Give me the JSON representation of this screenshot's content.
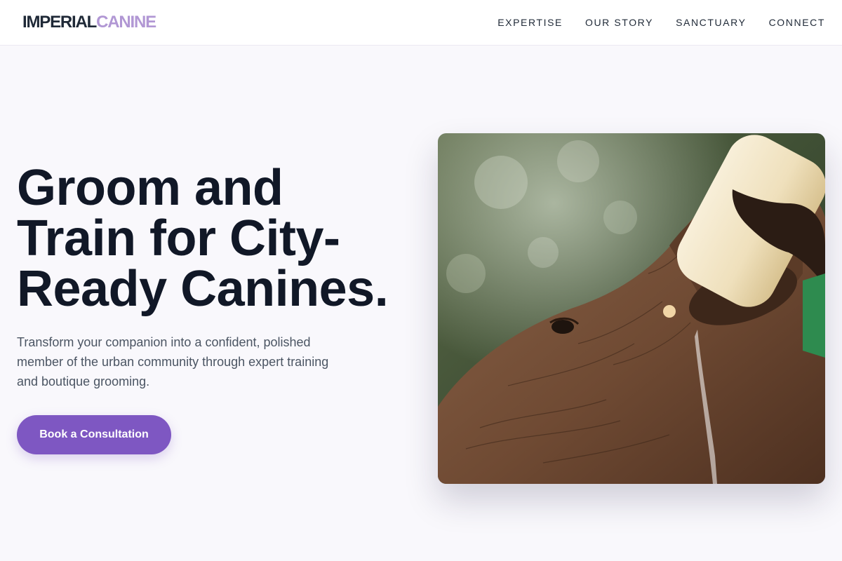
{
  "header": {
    "logo": {
      "primary": "IMPERIAL",
      "accent": "CANINE"
    },
    "nav": [
      {
        "label": "EXPERTISE"
      },
      {
        "label": "OUR STORY"
      },
      {
        "label": "SANCTUARY"
      },
      {
        "label": "CONNECT"
      }
    ]
  },
  "hero": {
    "title_lines": [
      "Groom and",
      "Train for City-",
      "Ready Canines."
    ],
    "subtitle": "Transform your companion into a confident, polished member of the urban community through expert training and boutique grooming.",
    "cta_label": "Book a Consultation",
    "image": {
      "subject": "elephant-calf-bottle-feeding-photo"
    }
  },
  "colors": {
    "accent": "#7e57c2",
    "logo_accent": "#b197d4",
    "title": "#111827",
    "body_text": "#4b5563",
    "page_background": "#f9f8fc"
  }
}
